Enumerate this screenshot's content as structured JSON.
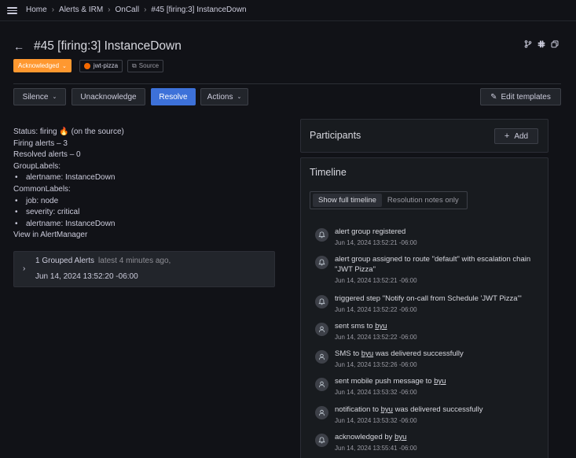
{
  "breadcrumb": {
    "items": [
      "Home",
      "Alerts & IRM",
      "OnCall"
    ],
    "current": "#45 [firing:3] InstanceDown",
    "separator": "›"
  },
  "header": {
    "back_icon": "arrow-left-icon",
    "title": "#45 [firing:3] InstanceDown",
    "action_icons": [
      "source-branch-icon",
      "slack-icon",
      "copy-icon"
    ]
  },
  "badges": {
    "status": "Acknowledged",
    "integration": "jwt-pizza",
    "source": "Source",
    "status_color": "#ff9830"
  },
  "actions": {
    "silence": "Silence",
    "unacknowledge": "Unacknowledge",
    "resolve": "Resolve",
    "actions": "Actions",
    "edit_templates": "Edit templates",
    "primary_color": "#3d71d9"
  },
  "details": {
    "status": "Status: firing 🔥 (on the source)",
    "firing": "Firing alerts – 3",
    "resolved": "Resolved alerts – 0",
    "group_labels_title": "GroupLabels:",
    "group_labels": [
      "alertname: InstanceDown"
    ],
    "common_labels_title": "CommonLabels:",
    "common_labels": [
      "job: node",
      "severity: critical",
      "alertname: InstanceDown"
    ],
    "view_link": "View in AlertManager"
  },
  "grouped": {
    "title": "1 Grouped Alerts",
    "meta": "latest 4 minutes ago,",
    "date": "Jun 14, 2024 13:52:20 -06:00"
  },
  "participants": {
    "title": "Participants",
    "add": "Add"
  },
  "timeline": {
    "title": "Timeline",
    "tabs": [
      "Show full timeline",
      "Resolution notes only"
    ],
    "events": [
      {
        "icon": "bell-icon",
        "parts": [
          "alert group registered"
        ],
        "time": "Jun 14, 2024 13:52:21 -06:00"
      },
      {
        "icon": "bell-icon",
        "parts": [
          "alert group assigned to route \"default\" with escalation chain \"JWT Pizza\""
        ],
        "time": "Jun 14, 2024 13:52:21 -06:00"
      },
      {
        "icon": "bell-icon",
        "parts": [
          "triggered step \"Notify on-call from Schedule 'JWT Pizza'\""
        ],
        "time": "Jun 14, 2024 13:52:22 -06:00"
      },
      {
        "icon": "user-icon",
        "parts": [
          "sent sms to ",
          "byu"
        ],
        "time": "Jun 14, 2024 13:52:22 -06:00"
      },
      {
        "icon": "user-icon",
        "parts": [
          "SMS to ",
          "byu",
          " was delivered successfully"
        ],
        "time": "Jun 14, 2024 13:52:26 -06:00"
      },
      {
        "icon": "user-icon",
        "parts": [
          "sent mobile push message to ",
          "byu"
        ],
        "time": "Jun 14, 2024 13:53:32 -06:00"
      },
      {
        "icon": "user-icon",
        "parts": [
          "notification to ",
          "byu",
          " was delivered successfully"
        ],
        "time": "Jun 14, 2024 13:53:32 -06:00"
      },
      {
        "icon": "bell-icon",
        "parts": [
          "acknowledged by ",
          "byu"
        ],
        "time": "Jun 14, 2024 13:55:41 -06:00"
      }
    ]
  }
}
